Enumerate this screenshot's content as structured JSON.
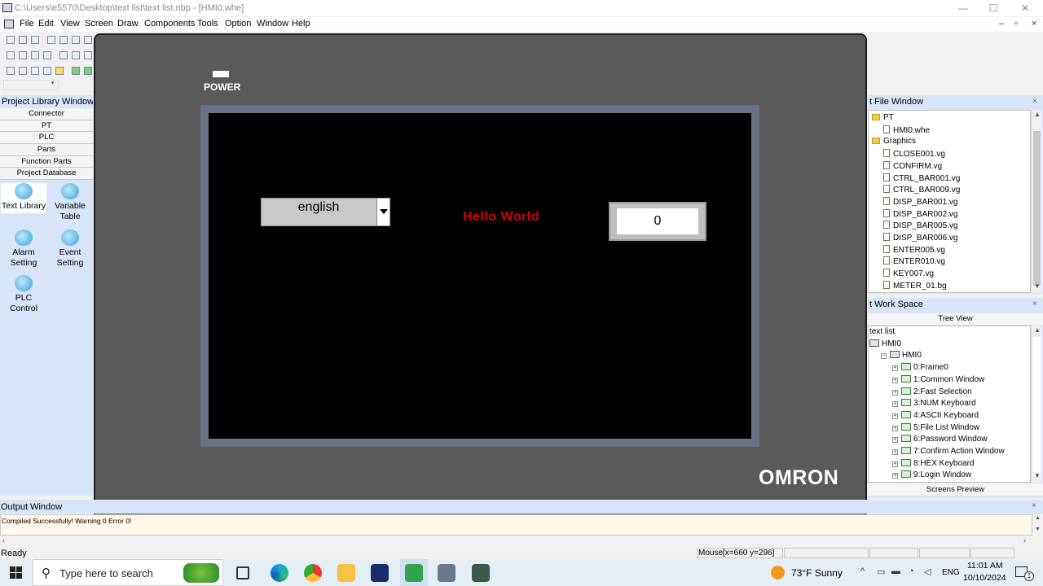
{
  "window": {
    "title": "C:\\Users\\e5570\\Desktop\\text list\\text list.nbp - [HMI0.whe]",
    "controls": [
      "—",
      "☐",
      "✕"
    ],
    "mdi_controls": [
      "–",
      "▫",
      "×"
    ]
  },
  "menu": [
    "File",
    "Edit",
    "View",
    "Screen",
    "Draw",
    "Components",
    "Tools",
    "Option",
    "Window",
    "Help"
  ],
  "project_library": {
    "title": "Project Library Window",
    "sections": [
      "Connector",
      "PT",
      "PLC",
      "Parts",
      "Function Parts",
      "Project Database"
    ],
    "items": [
      {
        "label": "Text Library",
        "icon": "text-library-icon"
      },
      {
        "label": "Variable Table",
        "icon": "variable-table-icon"
      },
      {
        "label": "Alarm Setting",
        "icon": "alarm-setting-icon"
      },
      {
        "label": "Event Setting",
        "icon": "event-setting-icon"
      },
      {
        "label": "PLC Control",
        "icon": "plc-control-icon"
      }
    ]
  },
  "hmi": {
    "power_label": "POWER",
    "dropdown_value": "english",
    "hello_text": "Hello World",
    "numeric_value": "0",
    "brand": "OMRON",
    "colors": {
      "hello": "#d00000",
      "body": "#5a5a5a",
      "screen": "#000000"
    }
  },
  "project_file_window": {
    "title": "t File Window",
    "tree": [
      {
        "label": "PT",
        "type": "folder",
        "level": 0
      },
      {
        "label": "HMI0.whe",
        "type": "file",
        "level": 1
      },
      {
        "label": "Graphics",
        "type": "folder",
        "level": 0
      },
      {
        "label": "CLOSE001.vg",
        "type": "file",
        "level": 1
      },
      {
        "label": "CONFIRM.vg",
        "type": "file",
        "level": 1
      },
      {
        "label": "CTRL_BAR001.vg",
        "type": "file",
        "level": 1
      },
      {
        "label": "CTRL_BAR009.vg",
        "type": "file",
        "level": 1
      },
      {
        "label": "DISP_BAR001.vg",
        "type": "file",
        "level": 1
      },
      {
        "label": "DISP_BAR002.vg",
        "type": "file",
        "level": 1
      },
      {
        "label": "DISP_BAR005.vg",
        "type": "file",
        "level": 1
      },
      {
        "label": "DISP_BAR006.vg",
        "type": "file",
        "level": 1
      },
      {
        "label": "ENTER005.vg",
        "type": "file",
        "level": 1
      },
      {
        "label": "ENTER010.vg",
        "type": "file",
        "level": 1
      },
      {
        "label": "KEY007.vg",
        "type": "file",
        "level": 1
      },
      {
        "label": "METER_01.bg",
        "type": "file",
        "level": 1
      }
    ]
  },
  "work_space": {
    "title": "t Work Space",
    "tab_top": "Tree View",
    "tab_bottom": "Screens Preview",
    "tree": [
      {
        "label": "text list",
        "level": 0
      },
      {
        "label": "HMI0",
        "level": 0
      },
      {
        "label": "HMI0",
        "level": 1
      },
      {
        "label": "0:Frame0",
        "level": 2
      },
      {
        "label": "1:Common Window",
        "level": 2
      },
      {
        "label": "2:Fast Selection",
        "level": 2
      },
      {
        "label": "3:NUM Keyboard",
        "level": 2
      },
      {
        "label": "4:ASCII Keyboard",
        "level": 2
      },
      {
        "label": "5:File List Window",
        "level": 2
      },
      {
        "label": "6:Password Window",
        "level": 2
      },
      {
        "label": "7:Confirm Action Window",
        "level": 2
      },
      {
        "label": "8:HEX Keyboard",
        "level": 2
      },
      {
        "label": "9:Login Window",
        "level": 2
      }
    ]
  },
  "output": {
    "title": "Output Window",
    "message": "Compiled Successfully! Warning 0 Error 0!"
  },
  "status": {
    "left": "Ready",
    "mouse": "Mouse[x=660  y=296]"
  },
  "taskbar": {
    "search_placeholder": "Type here to search",
    "weather": "73°F  Sunny",
    "lang": "ENG",
    "time": "11:01 AM",
    "date": "10/10/2024",
    "notification_count": "1"
  }
}
